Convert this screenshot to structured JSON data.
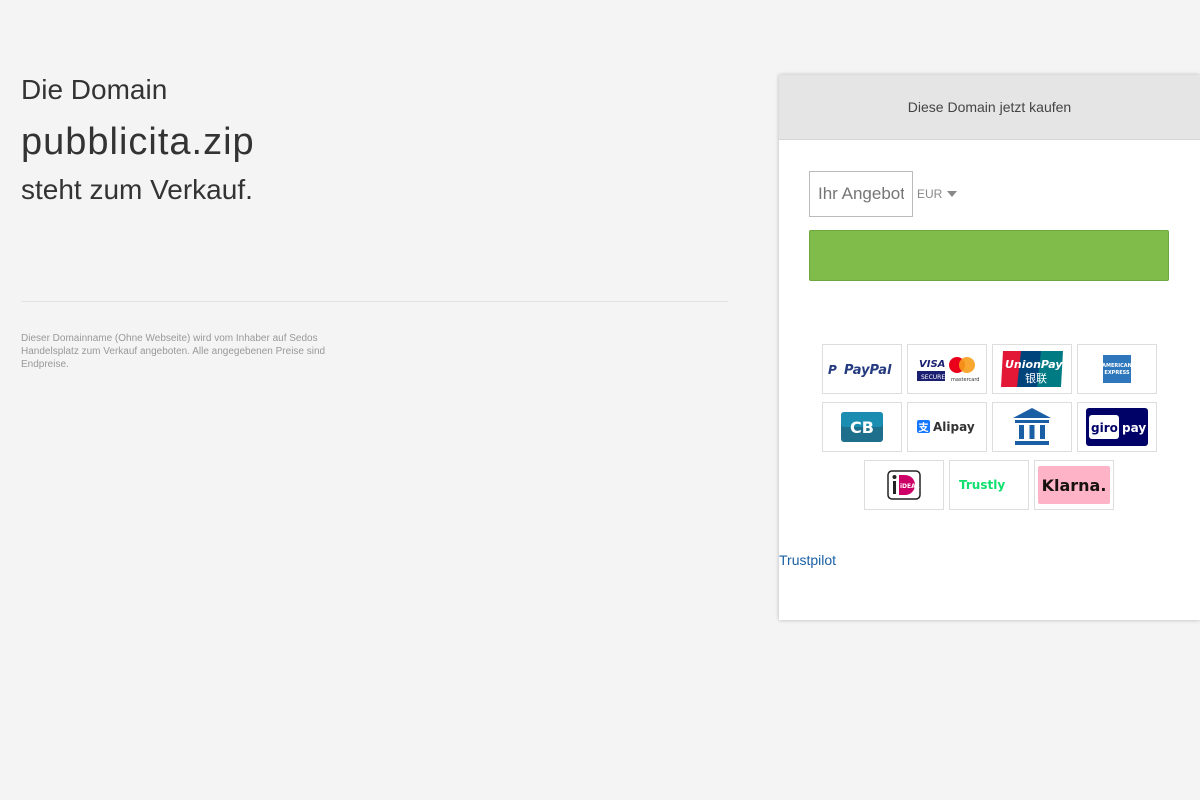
{
  "intro": {
    "line1": "Die Domain",
    "domain": "pubblicita.zip",
    "line2": "steht zum Verkauf."
  },
  "disclaimer": "Dieser Domainname (Ohne Webseite) wird vom Inhaber auf Sedos Handelsplatz zum Verkauf angeboten. Alle angegebenen Preise sind Endpreise.",
  "panel": {
    "title": "Diese Domain jetzt kaufen",
    "offer_placeholder": "Ihr Angebot",
    "currency": "EUR",
    "buy_label": "",
    "trust_link": "Trustpilot"
  },
  "payment_methods": {
    "paypal": "PayPal",
    "visa": "VISA",
    "visa_sub": "SECURE",
    "mastercard": "mastercard",
    "unionpay": "UnionPay",
    "unionpay_cn": "银联",
    "amex": "AMERICAN EXPRESS",
    "cb": "CB",
    "alipay": "Alipay",
    "giro": "giro",
    "giropay": "pay",
    "ideal": "iDEAL",
    "trustly": "Trustly",
    "klarna": "Klarna."
  },
  "colors": {
    "background": "#f4f4f4",
    "buy_button": "#7fbc4a",
    "link": "#1a5fa5",
    "panel_header": "#e5e5e5"
  }
}
